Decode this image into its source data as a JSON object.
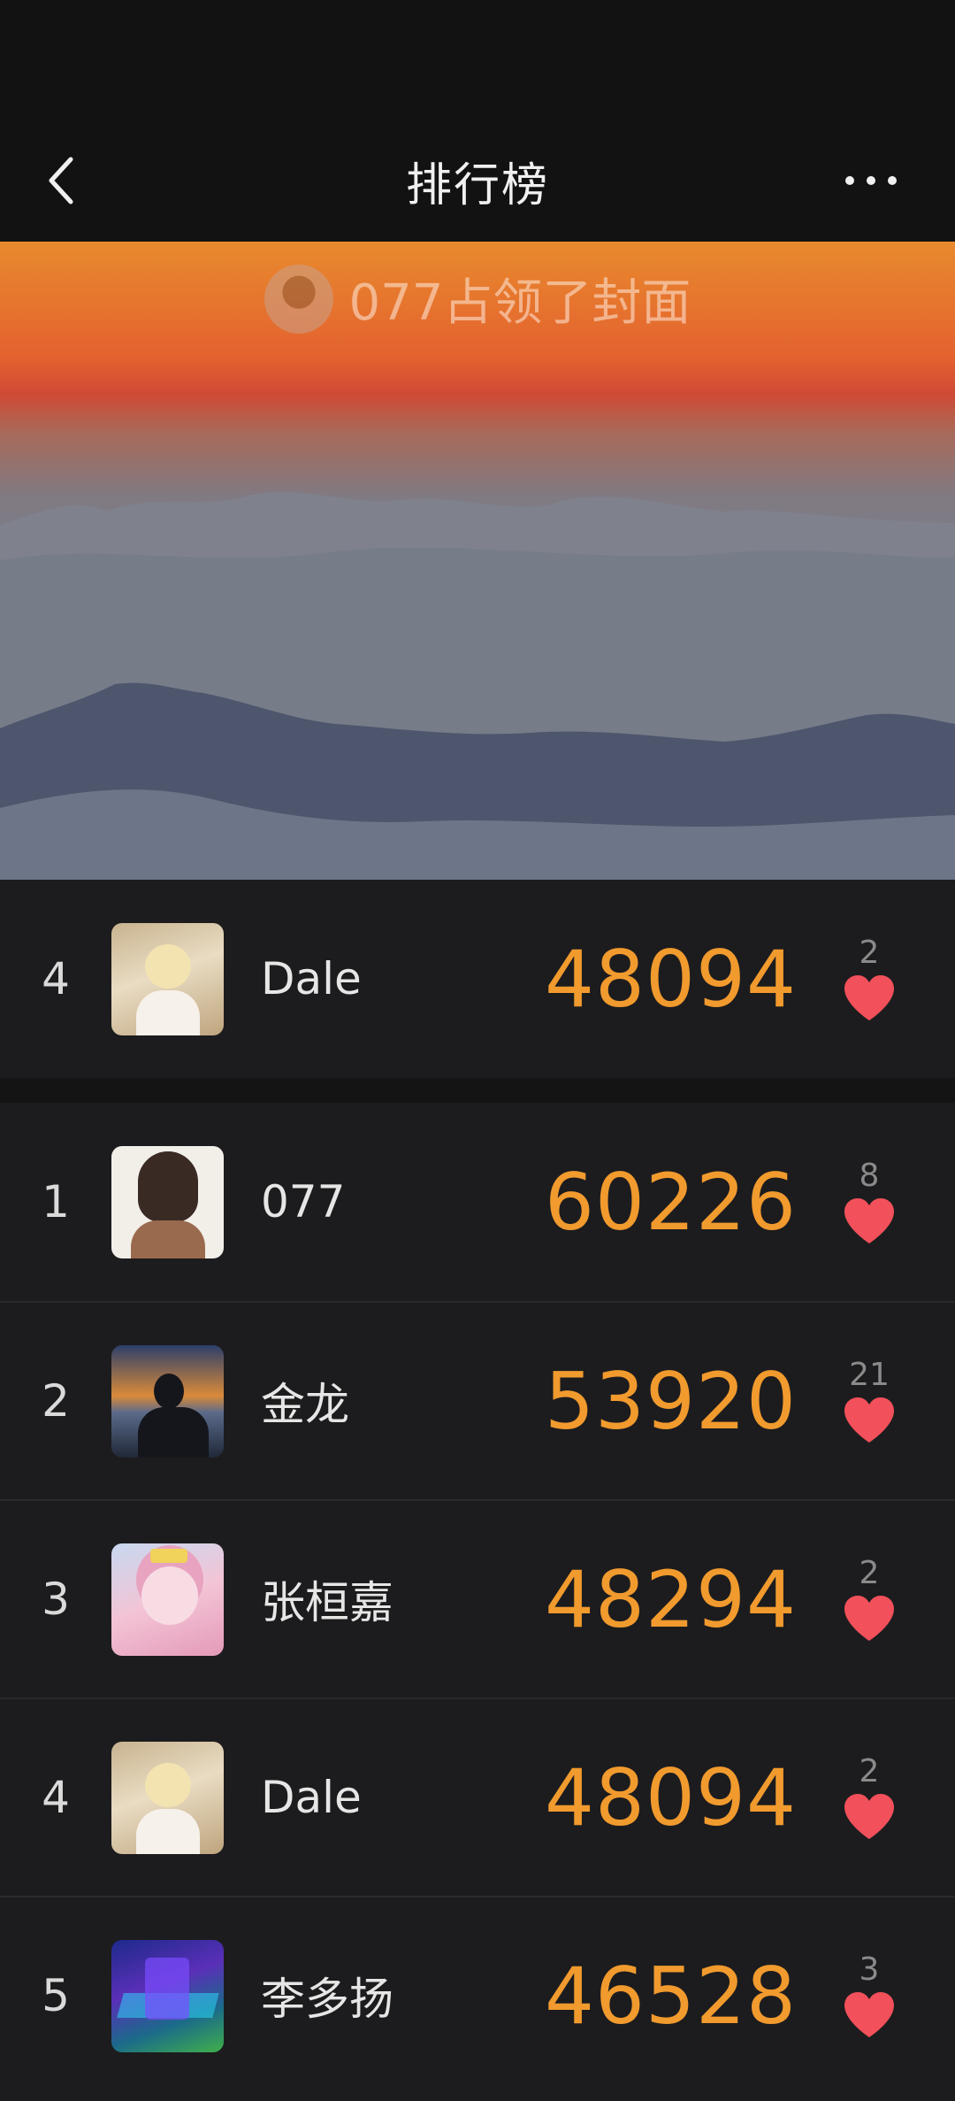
{
  "header": {
    "title": "排行榜",
    "back_icon": "chevron-left-icon",
    "more_icon": "more-horizontal-icon"
  },
  "cover": {
    "caption": "077占领了封面",
    "accent_top": "#e88a2e",
    "accent_mid": "#cf4a35"
  },
  "my_rank": {
    "rank": "4",
    "name": "Dale",
    "score": "48094",
    "likes": "2"
  },
  "leaderboard": [
    {
      "rank": "1",
      "name": "077",
      "score": "60226",
      "likes": "8"
    },
    {
      "rank": "2",
      "name": "金龙",
      "score": "53920",
      "likes": "21"
    },
    {
      "rank": "3",
      "name": "张桓嘉",
      "score": "48294",
      "likes": "2"
    },
    {
      "rank": "4",
      "name": "Dale",
      "score": "48094",
      "likes": "2"
    },
    {
      "rank": "5",
      "name": "李多扬",
      "score": "46528",
      "likes": "3"
    }
  ],
  "colors": {
    "score": "#f19a2e",
    "heart": "#f2505a",
    "background": "#1c1c1e"
  }
}
